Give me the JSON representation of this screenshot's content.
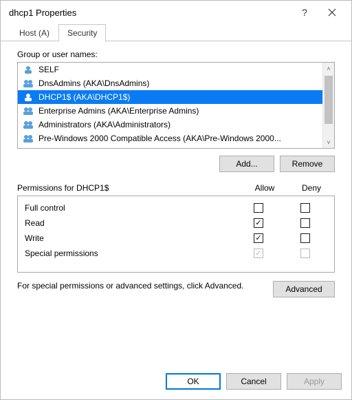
{
  "title": "dhcp1 Properties",
  "tabs": [
    {
      "label": "Host (A)",
      "active": false
    },
    {
      "label": "Security",
      "active": true
    }
  ],
  "groups_label": "Group or user names:",
  "principals": [
    {
      "name": "SELF",
      "kind": "user",
      "selected": false
    },
    {
      "name": "DnsAdmins (AKA\\DnsAdmins)",
      "kind": "group",
      "selected": false
    },
    {
      "name": "DHCP1$ (AKA\\DHCP1$)",
      "kind": "user",
      "selected": true
    },
    {
      "name": "Enterprise Admins (AKA\\Enterprise Admins)",
      "kind": "group",
      "selected": false
    },
    {
      "name": "Administrators (AKA\\Administrators)",
      "kind": "group",
      "selected": false
    },
    {
      "name": "Pre-Windows 2000 Compatible Access (AKA\\Pre-Windows 2000...",
      "kind": "group",
      "selected": false
    }
  ],
  "add_label": "Add...",
  "remove_label": "Remove",
  "perm_title": "Permissions for DHCP1$",
  "allow_col": "Allow",
  "deny_col": "Deny",
  "permissions": [
    {
      "name": "Full control",
      "allow": false,
      "deny": false,
      "disabled": false
    },
    {
      "name": "Read",
      "allow": true,
      "deny": false,
      "disabled": false
    },
    {
      "name": "Write",
      "allow": true,
      "deny": false,
      "disabled": false
    },
    {
      "name": "Special permissions",
      "allow": true,
      "deny": false,
      "disabled": true
    }
  ],
  "adv_text": "For special permissions or advanced settings, click Advanced.",
  "adv_button": "Advanced",
  "ok": "OK",
  "cancel": "Cancel",
  "apply": "Apply"
}
